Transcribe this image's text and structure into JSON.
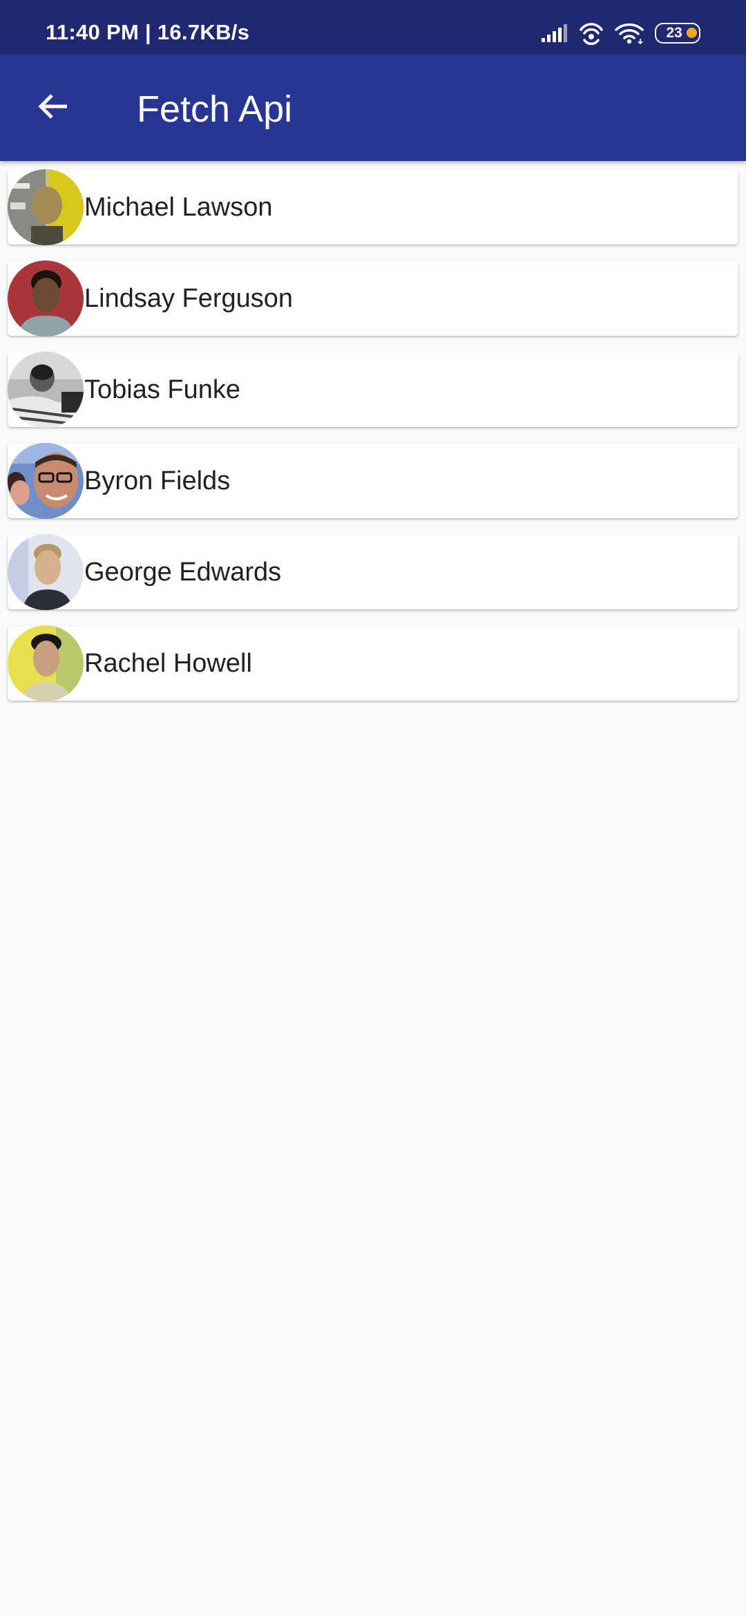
{
  "status_bar": {
    "time_speed": "11:40 PM | 16.7KB/s",
    "battery": "23",
    "icons": [
      "signal-icon",
      "hotspot-icon",
      "wifi-icon",
      "battery-icon"
    ]
  },
  "app_bar": {
    "back_icon": "arrow-back-icon",
    "title": "Fetch Api"
  },
  "colors": {
    "status_bar": "#1f2871",
    "app_bar": "#283593",
    "background": "#fafafa",
    "card": "#ffffff",
    "battery_dot": "#f5a623"
  },
  "users": [
    {
      "name": "Michael Lawson"
    },
    {
      "name": "Lindsay Ferguson"
    },
    {
      "name": "Tobias Funke"
    },
    {
      "name": "Byron Fields"
    },
    {
      "name": "George Edwards"
    },
    {
      "name": "Rachel Howell"
    }
  ]
}
